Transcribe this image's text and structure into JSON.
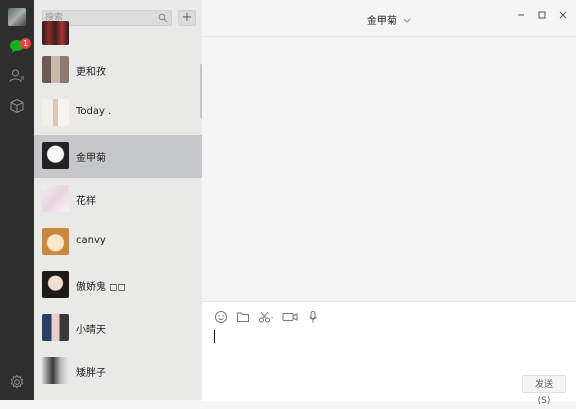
{
  "sidebar": {
    "badge_count": "1",
    "icons": [
      "avatar",
      "chat-icon",
      "contacts-icon",
      "favorites-icon",
      "settings-icon"
    ]
  },
  "search": {
    "placeholder": "搜索"
  },
  "list": {
    "add_label": "+",
    "items": [
      {
        "name": ""
      },
      {
        "name": "更和孜"
      },
      {
        "name": "Today ."
      },
      {
        "name": "金甲菊"
      },
      {
        "name": "花样"
      },
      {
        "name": "canvy"
      },
      {
        "name": "傲娇鬼 ◻◻"
      },
      {
        "name": "小晴天"
      },
      {
        "name": "矮胖子"
      }
    ]
  },
  "chat": {
    "title": "金甲菊",
    "send_label": "发送(S)"
  },
  "colors": {
    "rail": "#2e2e2e",
    "list_bg": "#e9e9e8",
    "active_item": "#c6c7c9",
    "badge": "#e64340",
    "chat_icon": "#1aad19"
  }
}
